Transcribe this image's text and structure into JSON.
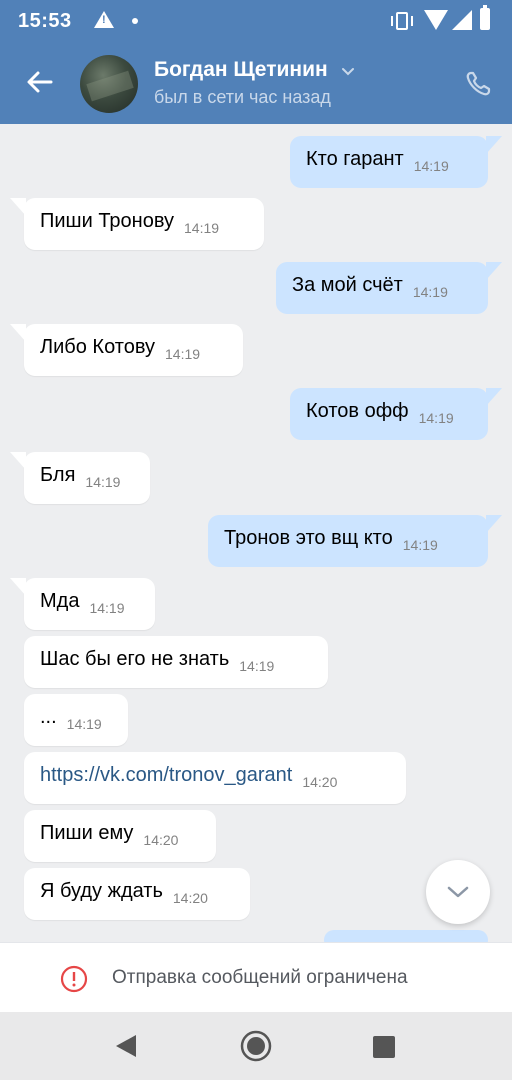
{
  "status_bar": {
    "time": "15:53"
  },
  "header": {
    "contact_name": "Богдан Щетинин",
    "contact_status": "был в сети час назад"
  },
  "messages": [
    {
      "side": "out",
      "text": "Кто гарант",
      "time": "14:19"
    },
    {
      "side": "in",
      "text": "Пиши Тронову",
      "time": "14:19"
    },
    {
      "side": "out",
      "text": "За мой счёт",
      "time": "14:19"
    },
    {
      "side": "in",
      "text": "Либо Котову",
      "time": "14:19"
    },
    {
      "side": "out",
      "text": "Котов офф",
      "time": "14:19"
    },
    {
      "side": "in",
      "text": "Бля",
      "time": "14:19"
    },
    {
      "side": "out",
      "text": "Тронов это вщ кто",
      "time": "14:19"
    },
    {
      "side": "in",
      "text": "Мда",
      "time": "14:19"
    },
    {
      "side": "in",
      "text": "Шас бы его не знать",
      "time": "14:19"
    },
    {
      "side": "in",
      "text": "...",
      "time": "14:19"
    },
    {
      "side": "in",
      "text": "https://vk.com/tronov_garant",
      "time": "14:20",
      "link": true
    },
    {
      "side": "in",
      "text": "Пиши ему",
      "time": "14:20"
    },
    {
      "side": "in",
      "text": "Я буду ждать",
      "time": "14:20"
    }
  ],
  "restriction_notice": "Отправка сообщений ограничена",
  "colors": {
    "header": "#5181b8",
    "outgoing_bubble": "#cce4ff",
    "incoming_bubble": "#ffffff",
    "chat_background": "#edeef0",
    "link": "#2a5885",
    "warning": "#e64646"
  },
  "icons": {
    "back": "arrow-left-icon",
    "dropdown": "chevron-down-icon",
    "call": "phone-icon",
    "scroll": "chevron-down-icon",
    "notice": "exclamation-circle-icon"
  }
}
